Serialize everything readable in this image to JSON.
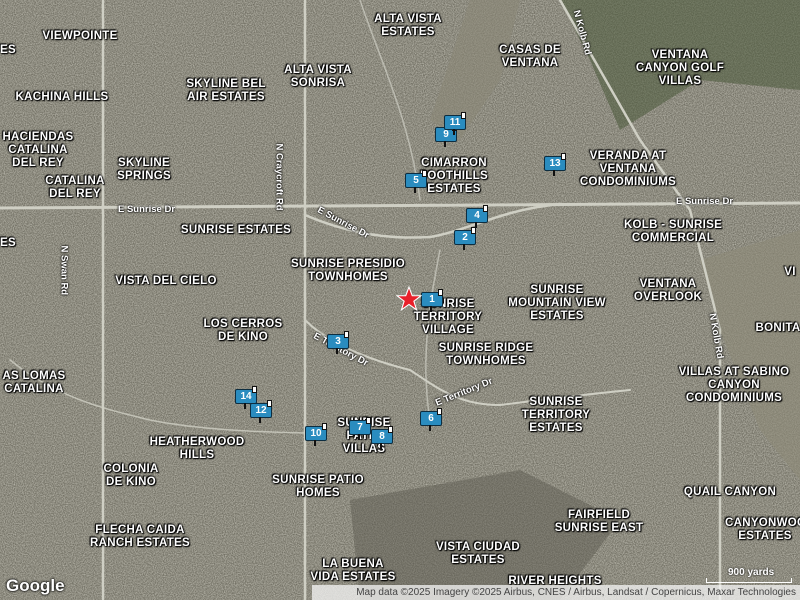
{
  "map": {
    "place_labels": [
      {
        "id": "viewpointe",
        "text": "VIEWPOINTE"
      },
      {
        "id": "kachina-hills",
        "text": "KACHINA HILLS"
      },
      {
        "id": "skyline-bel-air",
        "text": "SKYLINE BEL AIR ESTATES"
      },
      {
        "id": "alta-vista-sonrisa",
        "text": "ALTA VISTA SONRISA"
      },
      {
        "id": "alta-vista-estates",
        "text": "ALTA VISTA ESTATES"
      },
      {
        "id": "casas-de-ventana",
        "text": "CASAS DE VENTANA"
      },
      {
        "id": "ventana-canyon-golf-villas",
        "text": "VENTANA CANYON GOLF VILLAS"
      },
      {
        "id": "haciendas-catalina",
        "text": "HACIENDAS CATALINA DEL REY"
      },
      {
        "id": "catalina-del-rey",
        "text": "CATALINA DEL REY"
      },
      {
        "id": "skyline-springs",
        "text": "SKYLINE SPRINGS"
      },
      {
        "id": "cimarron-foothills",
        "text": "CIMARRON FOOTHILLS ESTATES"
      },
      {
        "id": "veranda-ventana",
        "text": "VERANDA AT VENTANA CONDOMINIUMS"
      },
      {
        "id": "sunrise-estates",
        "text": "SUNRISE ESTATES"
      },
      {
        "id": "kolb-sunrise",
        "text": "KOLB - SUNRISE COMMERCIAL"
      },
      {
        "id": "sunrise-presidio",
        "text": "SUNRISE PRESIDIO TOWNHOMES"
      },
      {
        "id": "vista-del-cielo",
        "text": "VISTA DEL CIELO"
      },
      {
        "id": "sunrise-territory-village",
        "text": "SUNRISE TERRITORY VILLAGE"
      },
      {
        "id": "sunrise-mountain-view",
        "text": "SUNRISE MOUNTAIN VIEW ESTATES"
      },
      {
        "id": "ventana-overlook",
        "text": "VENTANA OVERLOOK"
      },
      {
        "id": "los-cerros",
        "text": "LOS CERROS DE KINO"
      },
      {
        "id": "sunrise-ridge",
        "text": "SUNRISE RIDGE TOWNHOMES"
      },
      {
        "id": "bonita",
        "text": "BONITA"
      },
      {
        "id": "las-lomas",
        "text": "AS LOMAS CATALINA"
      },
      {
        "id": "villas-sabino",
        "text": "VILLAS AT SABINO CANYON CONDOMINIUMS"
      },
      {
        "id": "sunrise-territory-estates",
        "text": "SUNRISE TERRITORY ESTATES"
      },
      {
        "id": "heatherwood",
        "text": "HEATHERWOOD HILLS"
      },
      {
        "id": "sunrise-patio-villas",
        "text": "SUNRISE PATIO VILLAS"
      },
      {
        "id": "colonia-de-kino",
        "text": "COLONIA DE KINO"
      },
      {
        "id": "sunrise-patio-homes",
        "text": "SUNRISE PATIO HOMES"
      },
      {
        "id": "quail-canyon",
        "text": "QUAIL CANYON"
      },
      {
        "id": "flecha-caida",
        "text": "FLECHA CAIDA RANCH ESTATES"
      },
      {
        "id": "fairfield-sunrise",
        "text": "FAIRFIELD SUNRISE EAST"
      },
      {
        "id": "canyonwood",
        "text": "CANYONWOOD ESTATES"
      },
      {
        "id": "vista-ciudad",
        "text": "VISTA CIUDAD ESTATES"
      },
      {
        "id": "la-buena-vida",
        "text": "LA BUENA VIDA ESTATES"
      },
      {
        "id": "river-heights",
        "text": "RIVER HEIGHTS"
      },
      {
        "id": "left-edge-1",
        "text": "ES"
      },
      {
        "id": "left-edge-2",
        "text": "ES"
      },
      {
        "id": "right-edge-1",
        "text": "VI"
      }
    ],
    "road_labels": [
      {
        "id": "e-sunrise-dr-west",
        "text": "E Sunrise Dr"
      },
      {
        "id": "e-sunrise-dr-mid",
        "text": "E Sunrise Dr"
      },
      {
        "id": "e-sunrise-dr-east",
        "text": "E Sunrise Dr"
      },
      {
        "id": "n-swan-rd",
        "text": "N Swan Rd"
      },
      {
        "id": "n-craycroft-rd",
        "text": "N Craycroft Rd"
      },
      {
        "id": "n-kolb-rd-north",
        "text": "N Kolb Rd"
      },
      {
        "id": "n-kolb-rd-south",
        "text": "N Kolb Rd"
      },
      {
        "id": "e-territory-dr-west",
        "text": "E Territory Dr"
      },
      {
        "id": "e-territory-dr-east",
        "text": "E Territory Dr"
      }
    ],
    "markers": [
      "1",
      "2",
      "3",
      "4",
      "5",
      "6",
      "7",
      "8",
      "9",
      "10",
      "11",
      "12",
      "13",
      "14"
    ],
    "selected_marker": "star",
    "colors": {
      "marker_fill": "#2a8cbf",
      "marker_border": "#0d2d40",
      "star": "#e8202a"
    }
  },
  "branding": {
    "logo": "Google"
  },
  "attribution": "Map data ©2025 Imagery ©2025 Airbus, CNES / Airbus, Landsat / Copernicus, Maxar Technologies",
  "scale": {
    "label": "900 yards"
  }
}
